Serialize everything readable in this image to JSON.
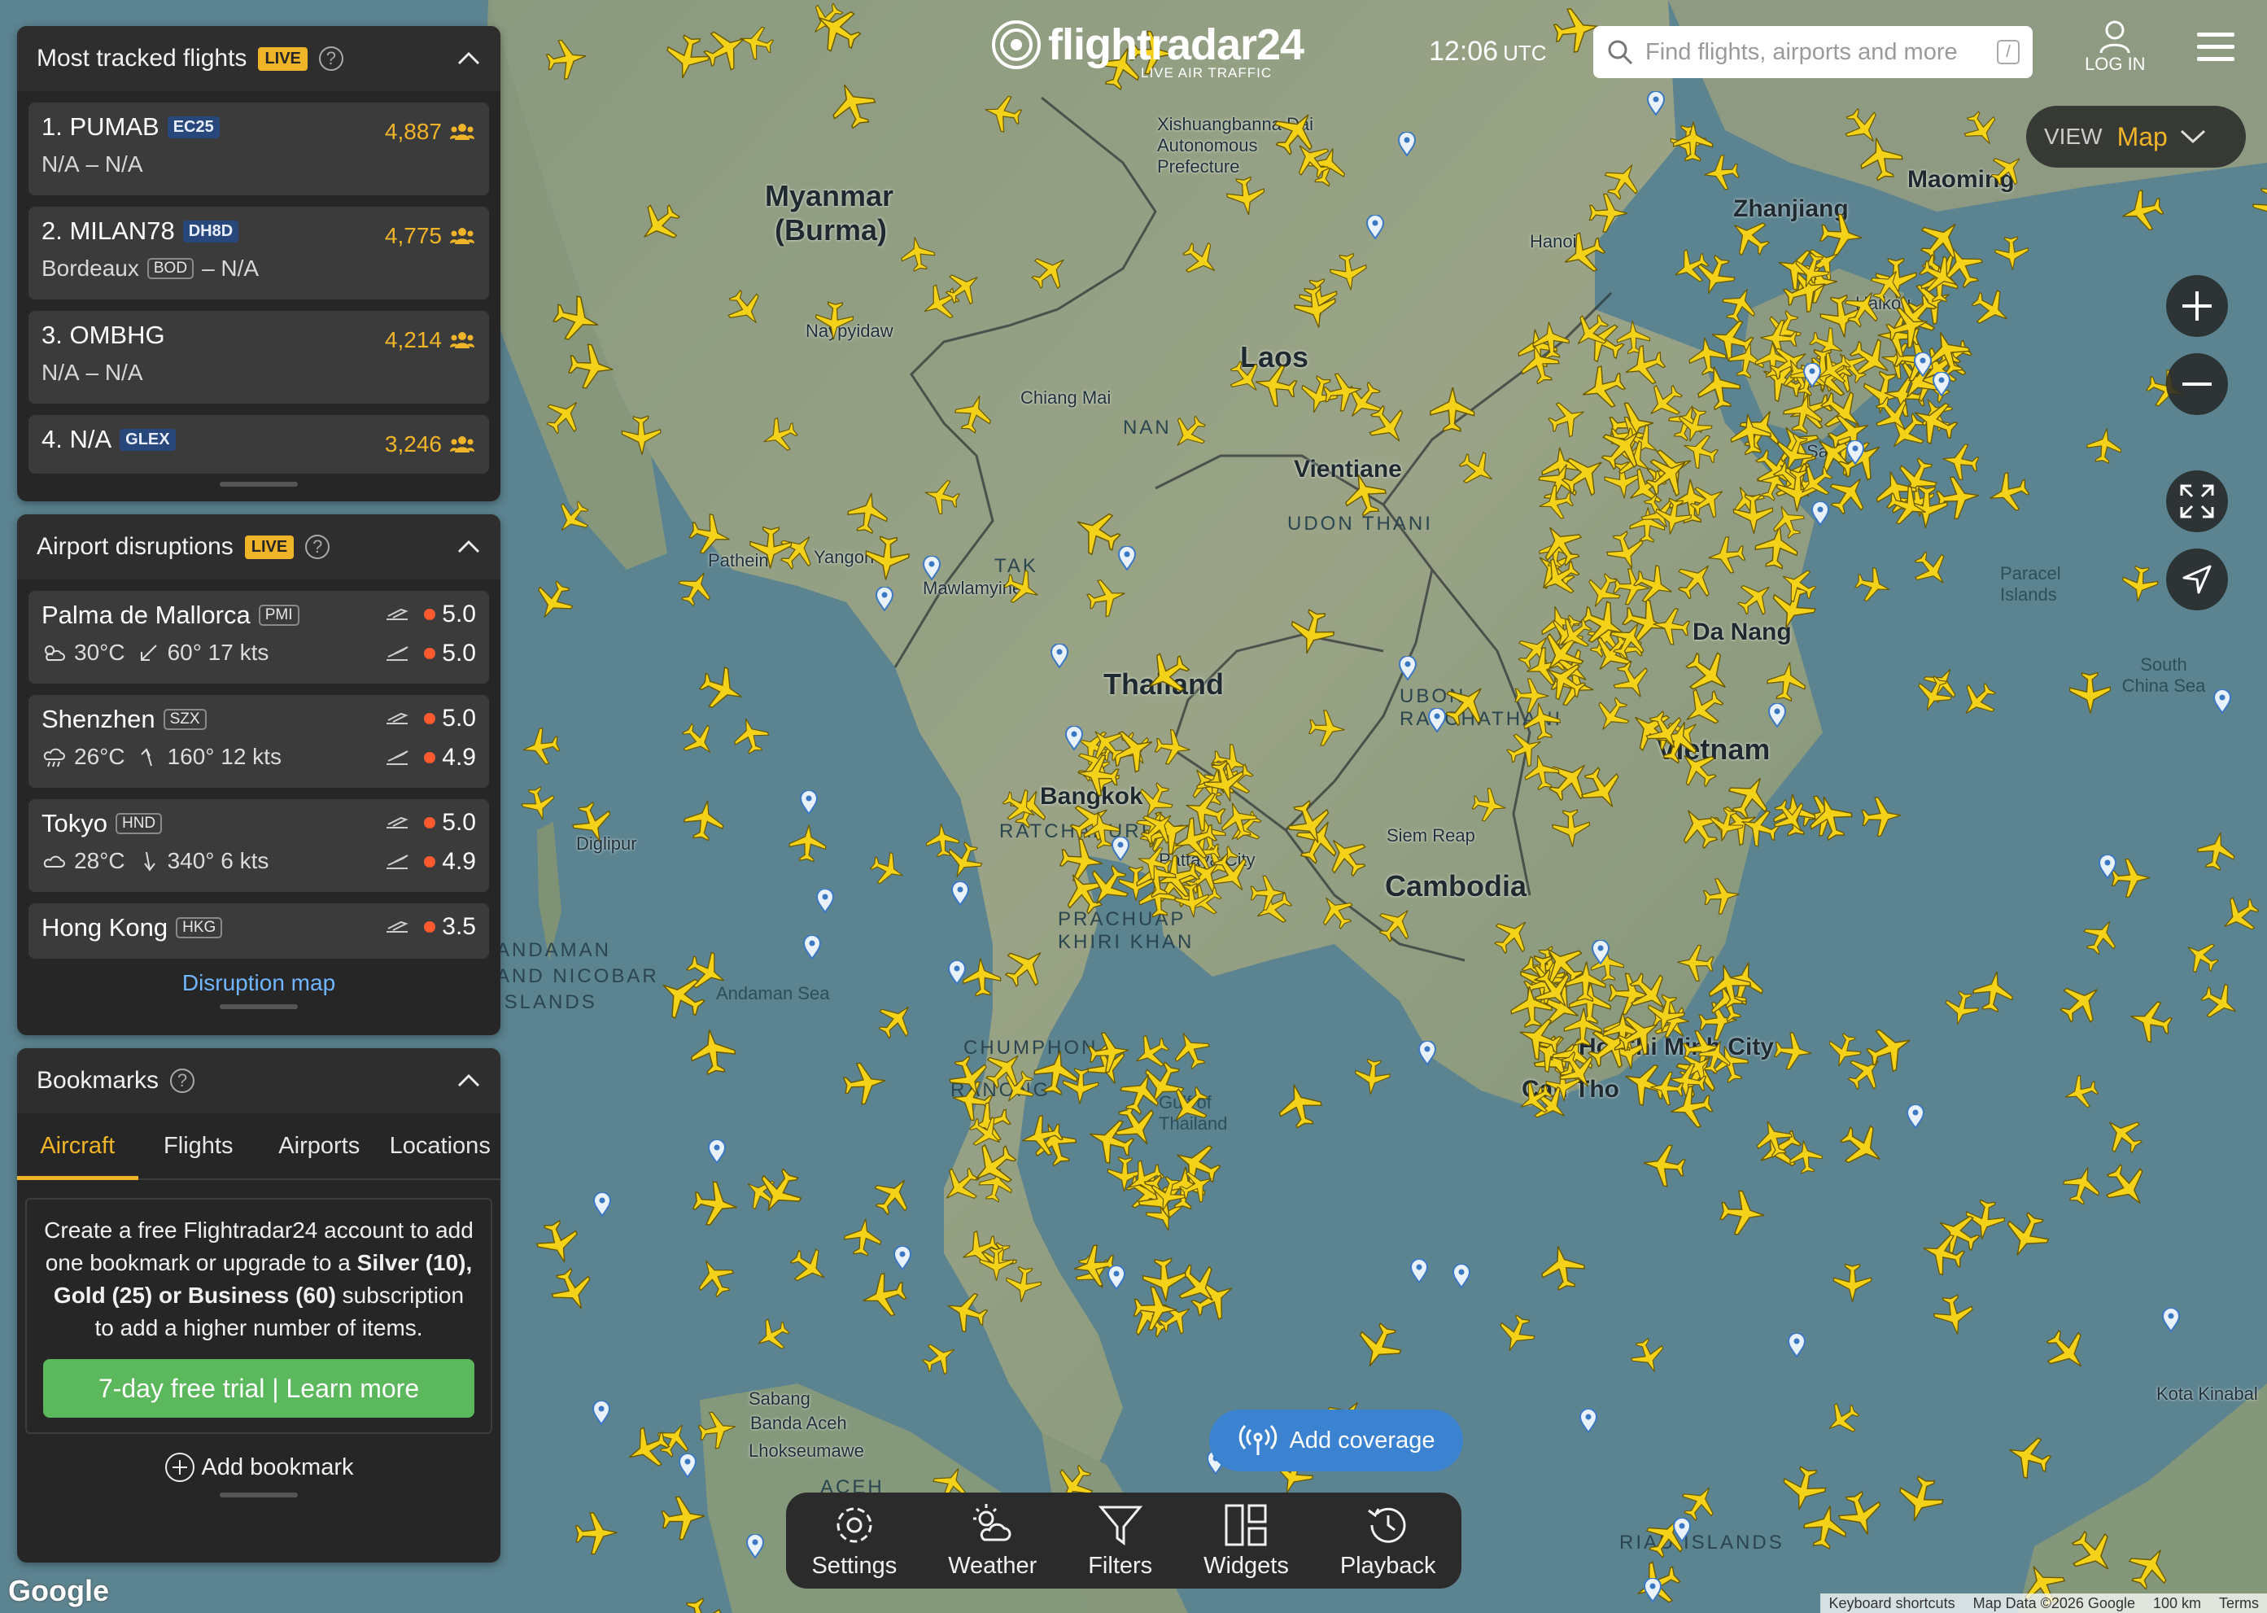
{
  "header": {
    "logo_text": "flightradar24",
    "logo_sub": "LIVE AIR TRAFFIC",
    "time": "12:06",
    "time_zone": "UTC",
    "search_placeholder": "Find flights, airports and more",
    "search_shortcut": "/",
    "login_label": "LOG IN"
  },
  "view": {
    "label": "VIEW",
    "value": "Map"
  },
  "tracked": {
    "title": "Most tracked flights",
    "live": "LIVE",
    "items": [
      {
        "rank_callsign": "1. PUMAB",
        "type": "EC25",
        "count": "4,887",
        "from": "N/A",
        "from_code": "",
        "sep": "–",
        "to": "N/A"
      },
      {
        "rank_callsign": "2. MILAN78",
        "type": "DH8D",
        "count": "4,775",
        "from": "Bordeaux",
        "from_code": "BOD",
        "sep": "–",
        "to": "N/A"
      },
      {
        "rank_callsign": "3. OMBHG",
        "type": "",
        "count": "4,214",
        "from": "N/A",
        "from_code": "",
        "sep": "–",
        "to": "N/A"
      },
      {
        "rank_callsign": "4. N/A",
        "type": "GLEX",
        "count": "3,246"
      }
    ]
  },
  "disruptions": {
    "title": "Airport disruptions",
    "live": "LIVE",
    "link": "Disruption map",
    "items": [
      {
        "name": "Palma de Mallorca",
        "code": "PMI",
        "temp": "30°C",
        "wind": "60° 17 kts",
        "dep": "5.0",
        "arr": "5.0"
      },
      {
        "name": "Shenzhen",
        "code": "SZX",
        "temp": "26°C",
        "wind": "160° 12 kts",
        "dep": "5.0",
        "arr": "4.9"
      },
      {
        "name": "Tokyo",
        "code": "HND",
        "temp": "28°C",
        "wind": "340° 6 kts",
        "dep": "5.0",
        "arr": "4.9"
      },
      {
        "name": "Hong Kong",
        "code": "HKG",
        "dep": "3.5"
      }
    ]
  },
  "bookmarks": {
    "title": "Bookmarks",
    "tabs": [
      "Aircraft",
      "Flights",
      "Airports",
      "Locations"
    ],
    "promo_1": "Create a free Flightradar24 account to add one bookmark or upgrade to a",
    "promo_bold": "Silver (10), Gold (25) or Business (60)",
    "promo_2": "subscription to add a higher number of items.",
    "cta": "7-day free trial | Learn more",
    "add": "Add bookmark"
  },
  "coverage_label": "Add coverage",
  "toolbar": {
    "settings": "Settings",
    "weather": "Weather",
    "filters": "Filters",
    "widgets": "Widgets",
    "playback": "Playback"
  },
  "map_labels": {
    "myanmar": "Myanmar",
    "burma": "(Burma)",
    "laos": "Laos",
    "thailand": "Thailand",
    "cambodia": "Cambodia",
    "vietnam": "Vietnam",
    "vientiane": "Vientiane",
    "yangon": "Yangon",
    "pathein": "Pathein",
    "mawlamyine": "Mawlamyine",
    "naypyidaw": "Naypyidaw",
    "chiang_mai": "Chiang Mai",
    "bangkok": "Bangkok",
    "pattaya": "Pattaya City",
    "siem_reap": "Siem Reap",
    "hcmc": "Ho Chi Minh City",
    "can_tho": "Can Tho",
    "da_nang": "Da Nang",
    "maoming": "Maoming",
    "zhanjiang": "Zhanjiang",
    "haikou": "Haikou",
    "sanya": "Sanya",
    "hanoi": "Hanoi",
    "xishuangbanna": "Xishuangbanna Dai Autonomous Prefecture",
    "andaman_sea": "Andaman Sea",
    "gulf_thailand": "Gulf of Thailand",
    "south_china_sea": "South China Sea",
    "paracel": "Paracel Islands",
    "diglipur": "Diglipur",
    "sabang": "Sabang",
    "banda_aceh": "Banda Aceh",
    "lhokseumawe": "Lhokseumawe",
    "kota_kinabalu": "Kota Kinabal",
    "andaman_nicobar": "ANDAMAN AND NICOBAR ISLANDS",
    "riau": "RIAU ISLANDS",
    "aceh": "ACEH",
    "chumphon": "CHUMPHON",
    "ranong": "RANONG",
    "prachuap": "PRACHUAP KHIRI KHAN",
    "ratchaburi": "RATCHABURI",
    "tak": "TAK",
    "nan": "NAN",
    "udon": "UDON THANI",
    "ubon": "UBON RATCHATHANI"
  },
  "attribution": {
    "google": "Google",
    "shortcuts": "Keyboard shortcuts",
    "map_data": "Map Data ©2026 Google",
    "scale": "100 km",
    "terms": "Terms"
  }
}
